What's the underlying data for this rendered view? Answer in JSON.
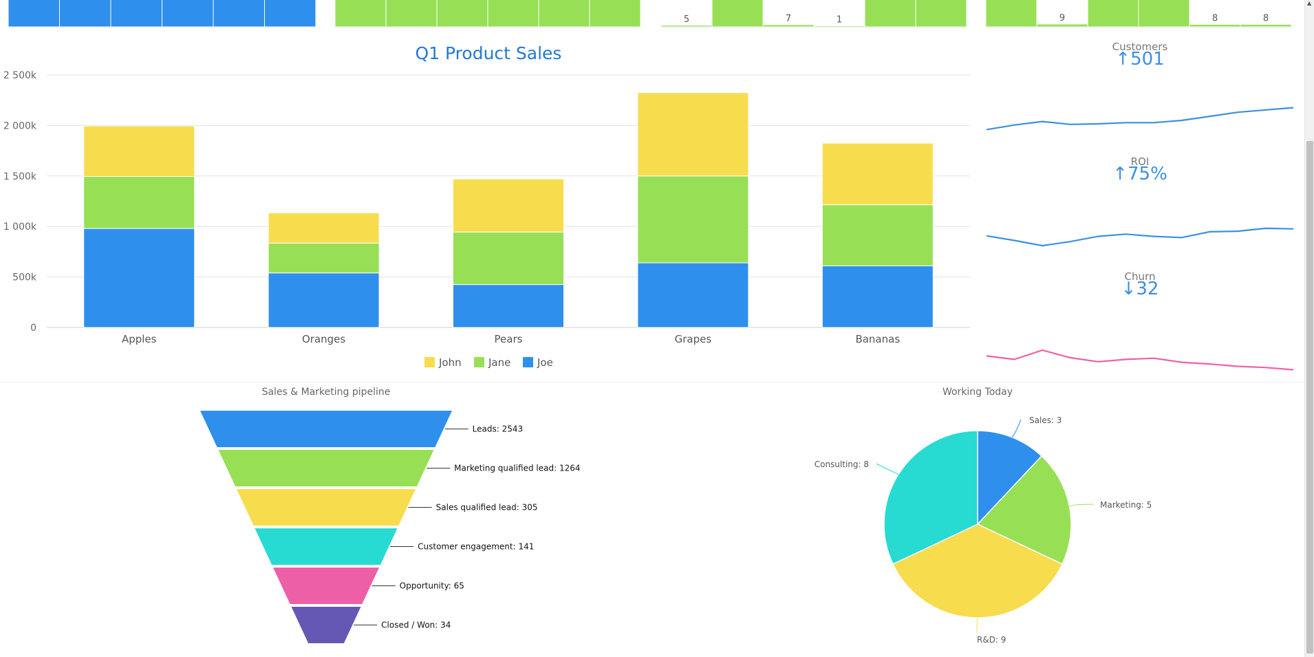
{
  "colors": {
    "blue": "#2f8fed",
    "green": "#97e056",
    "yellow": "#f7dc4e",
    "teal": "#27dbd2",
    "pink": "#ed60a8",
    "purple": "#6558b5",
    "title_blue": "#2378d1",
    "kpi_blue": "#3b8fe0",
    "gray_text": "#666666",
    "grid": "#e3e3e3"
  },
  "chart_data": [
    {
      "id": "top-partial-1",
      "type": "bar",
      "color": "blue",
      "values": [
        100,
        100,
        100,
        100,
        100,
        100
      ],
      "data_labels": []
    },
    {
      "id": "top-partial-2",
      "type": "bar",
      "color": "green",
      "values": [
        100,
        100,
        100,
        100,
        100,
        100
      ],
      "data_labels": []
    },
    {
      "id": "top-partial-3",
      "type": "bar",
      "color": "green",
      "values": [
        5,
        100,
        7,
        1,
        100,
        100
      ],
      "data_labels": [
        "5",
        "",
        "7",
        "1",
        "",
        ""
      ]
    },
    {
      "id": "top-partial-4",
      "type": "bar",
      "color": "green",
      "values": [
        100,
        9,
        100,
        100,
        8,
        8
      ],
      "data_labels": [
        "",
        "9",
        "",
        "",
        "8",
        "8"
      ]
    },
    {
      "id": "product-sales",
      "type": "bar",
      "stacked": true,
      "title": "Q1 Product Sales",
      "categories": [
        "Apples",
        "Oranges",
        "Pears",
        "Grapes",
        "Bananas"
      ],
      "series": [
        {
          "name": "Joe",
          "color": "blue",
          "values": [
            980000,
            540000,
            425000,
            640000,
            610000
          ]
        },
        {
          "name": "Jane",
          "color": "green",
          "values": [
            515000,
            295000,
            520000,
            860000,
            605000
          ]
        },
        {
          "name": "John",
          "color": "yellow",
          "values": [
            500000,
            300000,
            525000,
            825000,
            610000
          ]
        }
      ],
      "legend_order": [
        "John",
        "Jane",
        "Joe"
      ],
      "legend_position": "bottom-center",
      "ylim": [
        0,
        2500000
      ],
      "yticks": [
        0,
        500000,
        1000000,
        1500000,
        2000000,
        2500000
      ],
      "ytick_labels": [
        "0",
        "500k",
        "1 000k",
        "1 500k",
        "2 000k",
        "2 500k"
      ],
      "grid": true
    },
    {
      "id": "kpi-customers",
      "type": "line",
      "label": "Customers",
      "value_text": "↑501",
      "color": "kpi_blue",
      "values": [
        40,
        48,
        54,
        49,
        50,
        52,
        52,
        56,
        63,
        70,
        74,
        78
      ]
    },
    {
      "id": "kpi-roi",
      "type": "line",
      "label": "ROI",
      "value_text": "↑75%",
      "color": "kpi_blue",
      "values": [
        55,
        47,
        38,
        45,
        54,
        58,
        54,
        52,
        62,
        63,
        68,
        67
      ]
    },
    {
      "id": "kpi-churn",
      "type": "line",
      "label": "Churn",
      "value_text": "↓32",
      "color": "pink",
      "values": [
        46,
        40,
        56,
        43,
        36,
        40,
        42,
        35,
        32,
        28,
        26,
        22
      ]
    },
    {
      "id": "pipeline",
      "type": "funnel",
      "title": "Sales & Marketing pipeline",
      "stages": [
        {
          "label": "Leads: 2543",
          "value": 2543,
          "color": "blue"
        },
        {
          "label": "Marketing qualified lead: 1264",
          "value": 1264,
          "color": "green"
        },
        {
          "label": "Sales qualified lead: 305",
          "value": 305,
          "color": "yellow"
        },
        {
          "label": "Customer engagement: 141",
          "value": 141,
          "color": "teal"
        },
        {
          "label": "Opportunity: 65",
          "value": 65,
          "color": "pink"
        },
        {
          "label": "Closed / Won: 34",
          "value": 34,
          "color": "purple"
        }
      ]
    },
    {
      "id": "working-today",
      "type": "pie",
      "title": "Working Today",
      "slices": [
        {
          "label": "Sales: 3",
          "value": 3,
          "color": "blue"
        },
        {
          "label": "Marketing: 5",
          "value": 5,
          "color": "green"
        },
        {
          "label": "R&D: 9",
          "value": 9,
          "color": "yellow"
        },
        {
          "label": "Consulting: 8",
          "value": 8,
          "color": "teal"
        }
      ]
    }
  ]
}
